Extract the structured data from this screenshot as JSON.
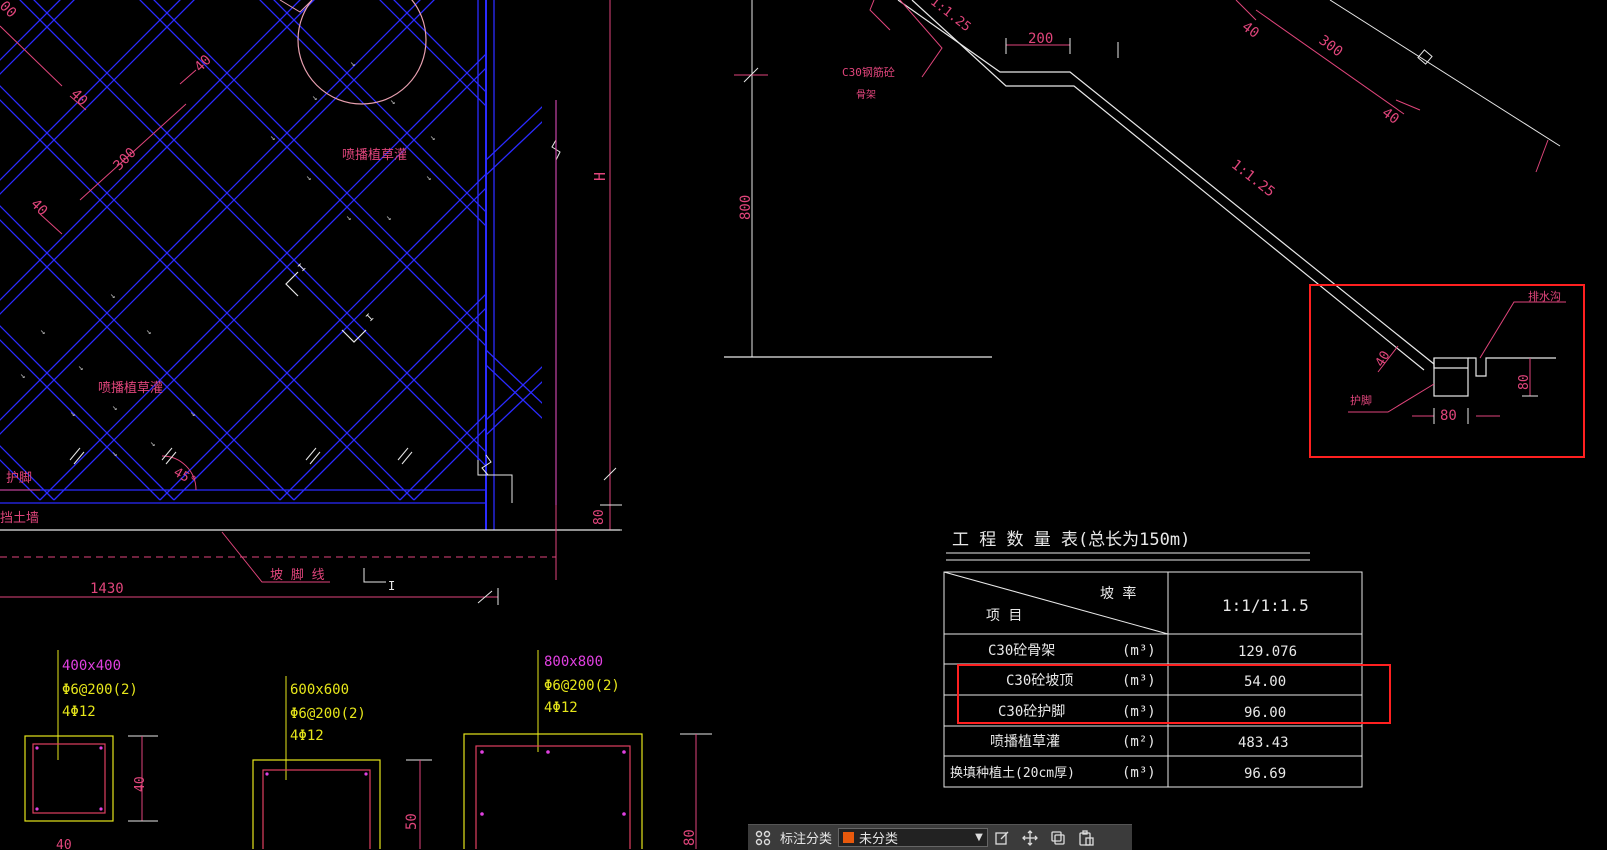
{
  "drawing": {
    "grid_label_1": "喷播植草灌",
    "grid_label_2": "喷播植草灌",
    "dim_300": "300",
    "dim_40_a": "40",
    "dim_40_b": "40",
    "dim_40_c": "40",
    "angle": "45°",
    "retaining_label": "护脚",
    "wall_label": "挡土墙",
    "slope_toe_line": "坡 脚 线",
    "dim_1430": "1430",
    "dim_80_left": "80",
    "dim_H": "H",
    "section_mark_1": "I",
    "section_mark_2": "I",
    "dim_800": "800",
    "c30_frame_label": "C30钢筋砼",
    "c30_frame_sub": "骨架",
    "dim_200": "200",
    "slope_ratio": "1:1.25",
    "slope_ratio_top": "1:1.25",
    "dim_300_top": "300",
    "dim_40_top": "40",
    "dim_40_right": "40",
    "dim_40_detail": "40",
    "drain_label": "排水沟",
    "guard_label": "护脚",
    "dim_80_detail_w": "80",
    "dim_80_detail_h": "80"
  },
  "sections": [
    {
      "size": "400x400",
      "stirrup": "Φ6@200(2)",
      "rebar": "4Φ12",
      "dim": "40"
    },
    {
      "size": "600x600",
      "stirrup": "Φ6@200(2)",
      "rebar": "4Φ12",
      "dim": "50"
    },
    {
      "size": "800x800",
      "stirrup": "Φ6@200(2)",
      "rebar": "4Φ12",
      "dim": "80"
    }
  ],
  "bottom_partial": "40",
  "table": {
    "title": "工 程 数 量 表(总长为150m)",
    "header_slope": "坡   率",
    "header_item": "项    目",
    "header_value": "1:1/1:1.5",
    "rows": [
      {
        "item": "C30砼骨架",
        "unit": "(m³)",
        "value": "129.076"
      },
      {
        "item": "C30砼坡顶",
        "unit": "(m³)",
        "value": "54.00"
      },
      {
        "item": "C30砼护脚",
        "unit": "(m³)",
        "value": "96.00"
      },
      {
        "item": "喷播植草灌",
        "unit": "(m²)",
        "value": "483.43"
      },
      {
        "item": "换填种植土(20cm厚)",
        "unit": "(m³)",
        "value": "96.69"
      }
    ]
  },
  "toolbar": {
    "label": "标注分类",
    "selected": "未分类",
    "swatch_color": "#e8590c"
  },
  "colors": {
    "blue": "#2b2bff",
    "red": "#e0457b",
    "white": "#e8e8e8",
    "yellow": "#e6e61a",
    "magenta": "#e040e0",
    "highlight": "#ff2020"
  }
}
